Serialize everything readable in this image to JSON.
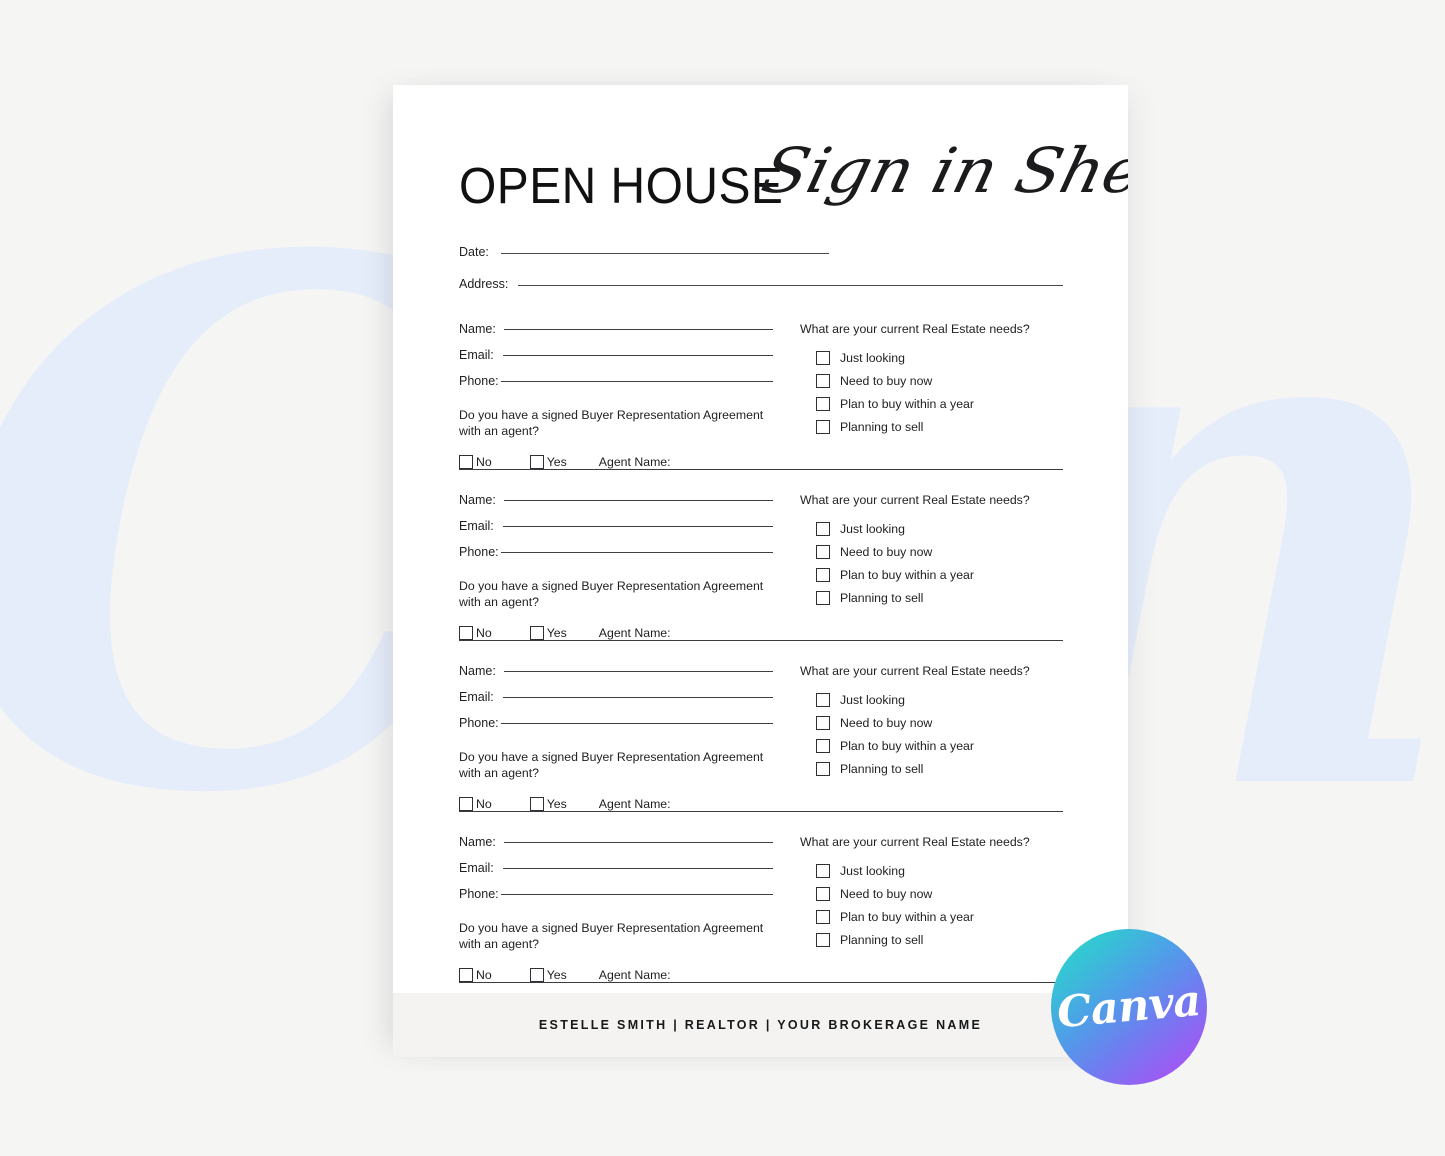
{
  "document": {
    "title_main": "OPEN HOUSE",
    "title_script": "Sign in Sheet",
    "meta": {
      "date_label": "Date:",
      "address_label": "Address:"
    },
    "labels": {
      "name": "Name:",
      "email": "Email:",
      "phone": "Phone:",
      "agreement_question": "Do you have a signed Buyer Representation Agreement with an agent?",
      "no": "No",
      "yes": "Yes",
      "agent_name": "Agent Name:",
      "needs_title": "What are your current Real Estate needs?"
    },
    "needs_options": [
      "Just looking",
      "Need to buy now",
      "Plan to buy within a year",
      "Planning to sell"
    ],
    "entries": [
      {
        "name_value": "",
        "email_value": "",
        "phone_value": "",
        "agent_name_value": ""
      },
      {
        "name_value": "",
        "email_value": "",
        "phone_value": "",
        "agent_name_value": ""
      },
      {
        "name_value": "",
        "email_value": "",
        "phone_value": "",
        "agent_name_value": ""
      },
      {
        "name_value": "",
        "email_value": "",
        "phone_value": "",
        "agent_name_value": ""
      }
    ],
    "footer": {
      "text": "ESTELLE SMITH | REALTOR | YOUR BROKERAGE NAME"
    }
  },
  "watermark": {
    "text": "Canva",
    "color": "#e6edfa"
  },
  "badge": {
    "wordmark": "Canva",
    "gradient_start": "#2ed3c6",
    "gradient_end": "#a855f7"
  },
  "canvas": {
    "background": "#f5f5f4",
    "page_background": "#ffffff",
    "footer_background": "#f4f3f1",
    "ink": "#1f1f22"
  }
}
